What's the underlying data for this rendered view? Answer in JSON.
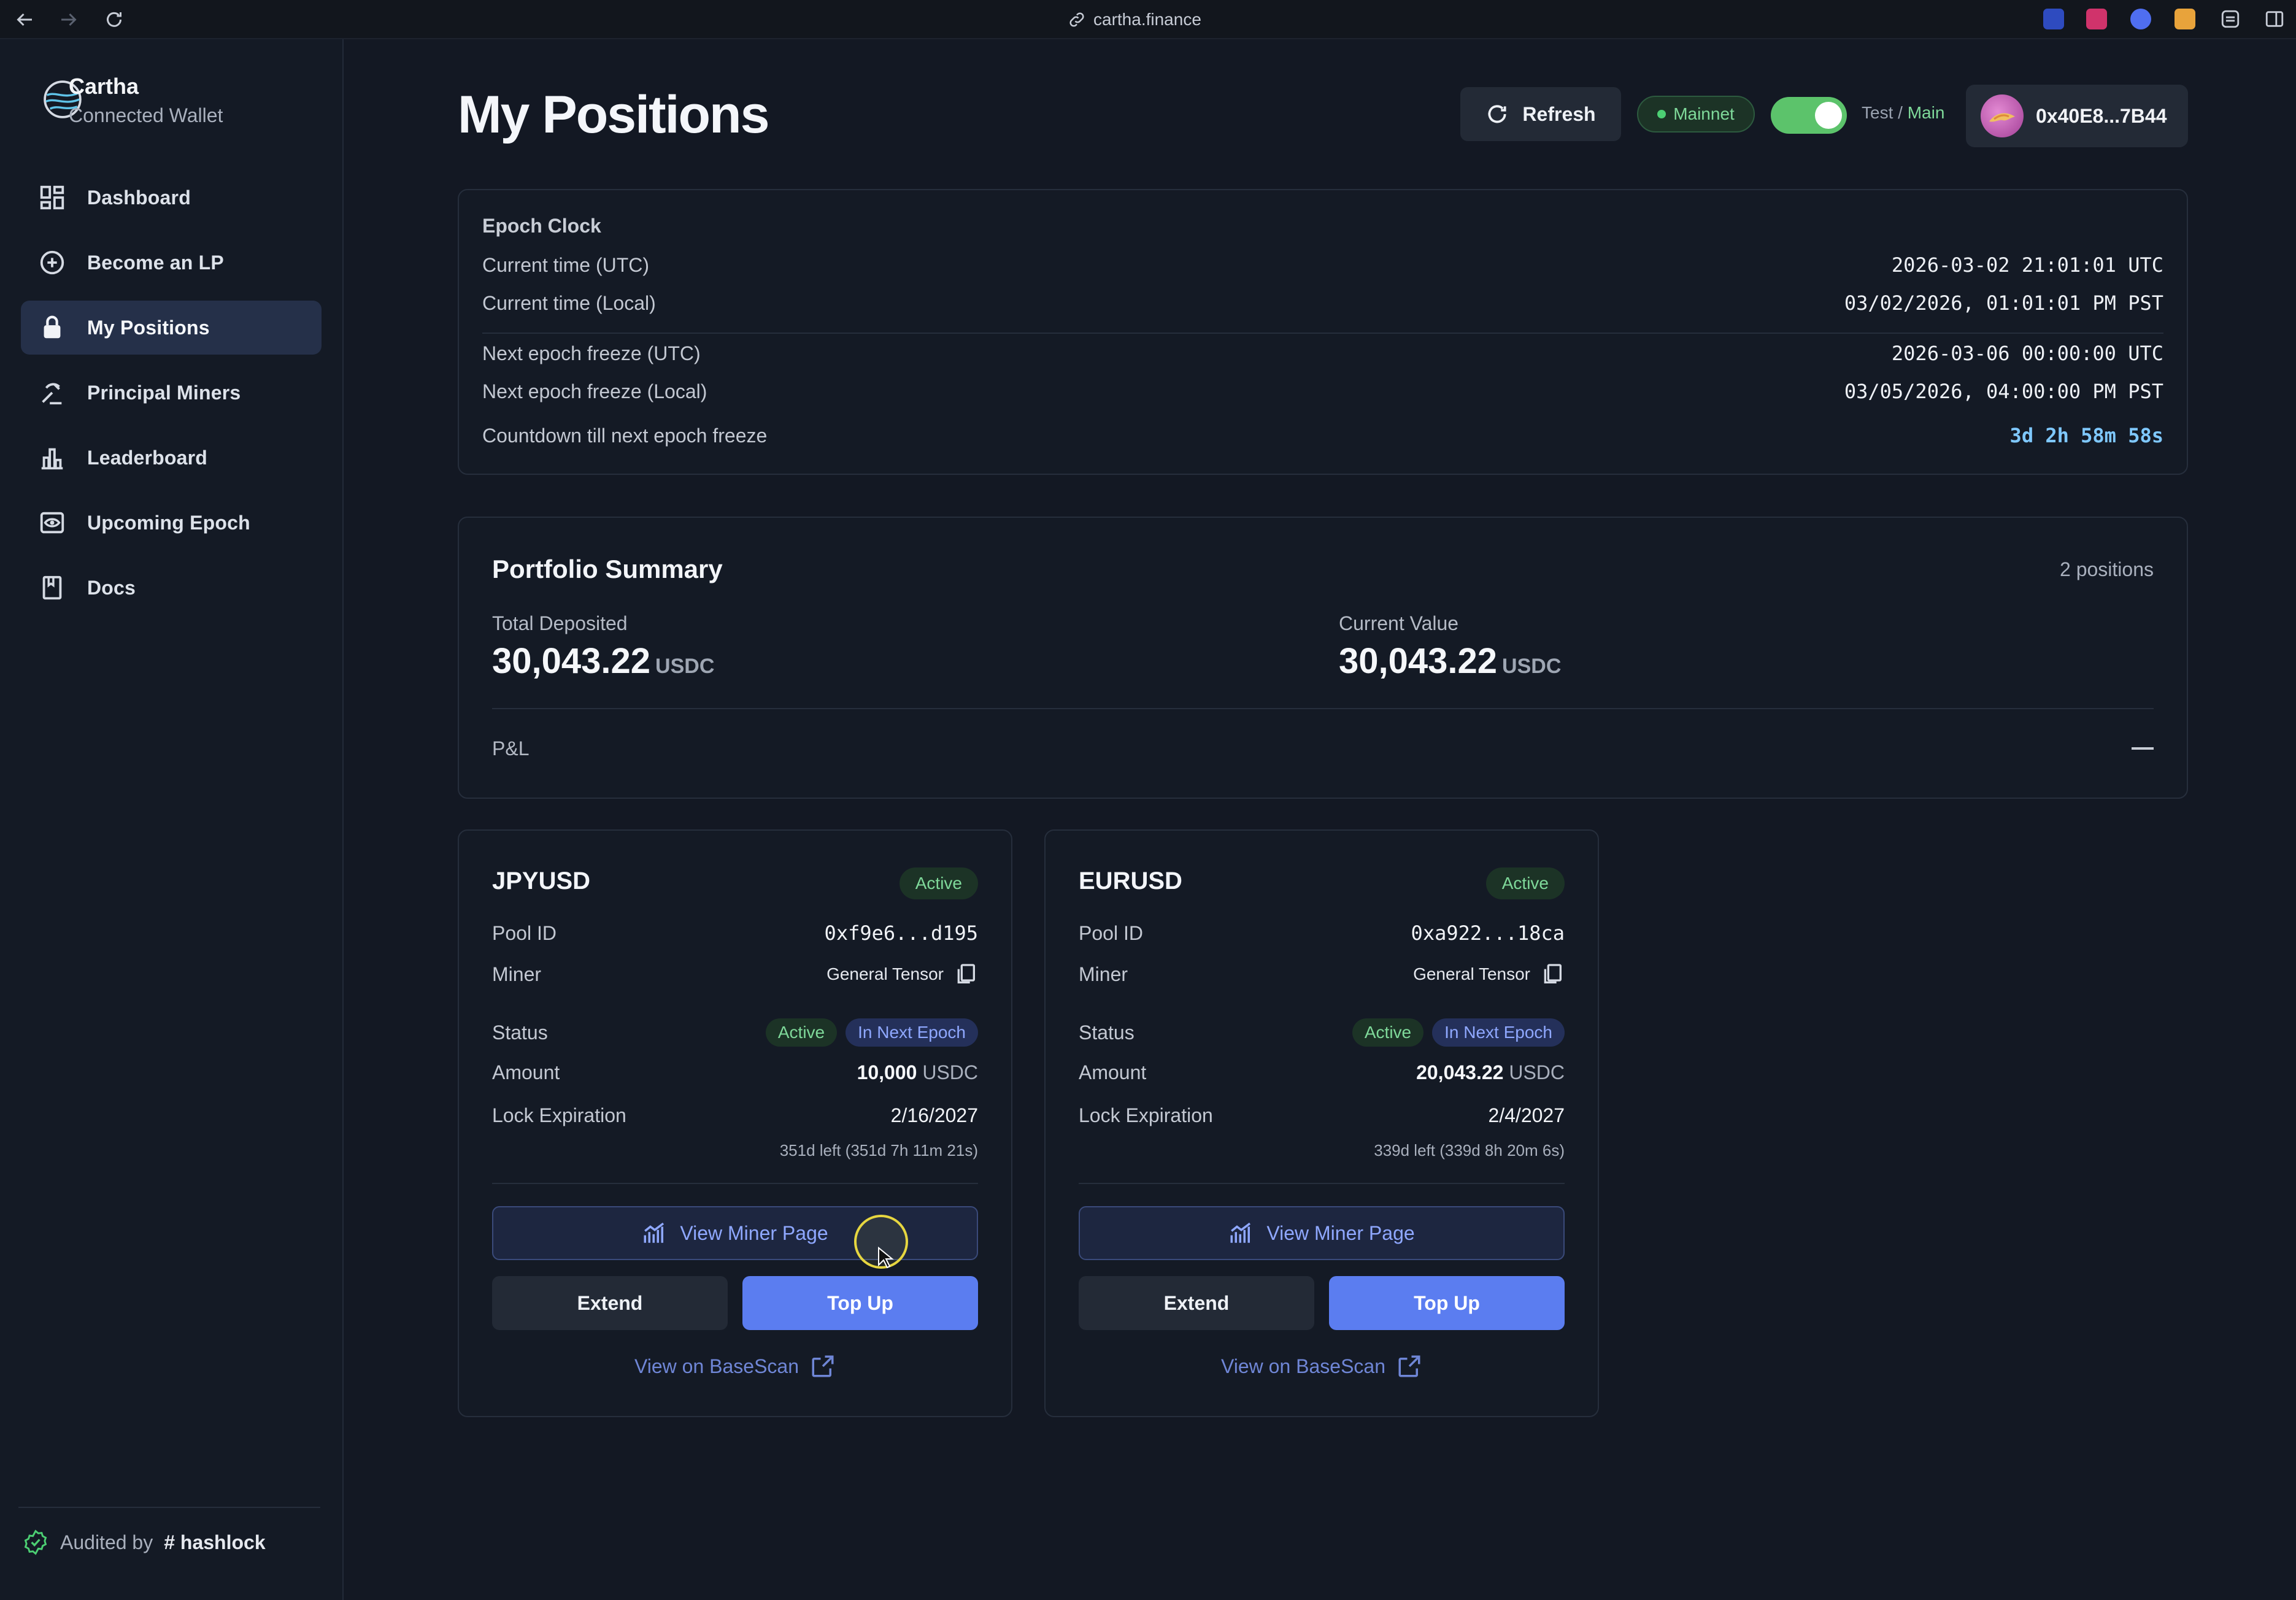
{
  "browser": {
    "url": "cartha.finance"
  },
  "sidebar": {
    "brand_title": "Cartha",
    "brand_subtitle": "Connected Wallet",
    "items": [
      {
        "label": "Dashboard",
        "icon": "dashboard-icon"
      },
      {
        "label": "Become an LP",
        "icon": "plus-circle-icon"
      },
      {
        "label": "My Positions",
        "icon": "lock-icon",
        "active": true
      },
      {
        "label": "Principal Miners",
        "icon": "mining-icon"
      },
      {
        "label": "Leaderboard",
        "icon": "bar-chart-icon"
      },
      {
        "label": "Upcoming Epoch",
        "icon": "eye-icon"
      },
      {
        "label": "Docs",
        "icon": "book-icon"
      }
    ],
    "audit_prefix": "Audited by",
    "audit_name": "# hashlock"
  },
  "header": {
    "title": "My Positions",
    "refresh_label": "Refresh",
    "network_label": "Mainnet",
    "toggle_test": "Test",
    "toggle_sep": " / ",
    "toggle_main": "Main",
    "wallet_address": "0x40E8...7B44"
  },
  "epoch": {
    "title": "Epoch Clock",
    "rows": [
      {
        "label": "Current time (UTC)",
        "value": "2026-03-02 21:01:01 UTC"
      },
      {
        "label": "Current time (Local)",
        "value": "03/02/2026, 01:01:01 PM PST"
      },
      {
        "label": "Next epoch freeze (UTC)",
        "value": "2026-03-06 00:00:00 UTC"
      },
      {
        "label": "Next epoch freeze (Local)",
        "value": "03/05/2026, 04:00:00 PM PST"
      },
      {
        "label": "Countdown till next epoch freeze",
        "value": "3d 2h 58m 58s"
      }
    ]
  },
  "portfolio": {
    "title": "Portfolio Summary",
    "count": "2 positions",
    "total_label": "Total Deposited",
    "total_value": "30,043.22",
    "current_label": "Current Value",
    "current_value": "30,043.22",
    "unit": "USDC",
    "pnl_label": "P&L"
  },
  "positions": [
    {
      "pair": "JPYUSD",
      "badge": "Active",
      "pool_label": "Pool ID",
      "pool_id": "0xf9e6...d195",
      "miner_label": "Miner",
      "miner": "General Tensor",
      "status_label": "Status",
      "status_1": "Active",
      "status_2": "In Next Epoch",
      "amount_label": "Amount",
      "amount": "10,000",
      "amount_unit": "USDC",
      "lock_label": "Lock Expiration",
      "lock_date": "2/16/2027",
      "lock_left": "351d left (351d 7h 11m 21s)",
      "view_miner": "View Miner Page",
      "extend": "Extend",
      "topup": "Top Up",
      "basescan": "View on BaseScan"
    },
    {
      "pair": "EURUSD",
      "badge": "Active",
      "pool_label": "Pool ID",
      "pool_id": "0xa922...18ca",
      "miner_label": "Miner",
      "miner": "General Tensor",
      "status_label": "Status",
      "status_1": "Active",
      "status_2": "In Next Epoch",
      "amount_label": "Amount",
      "amount": "20,043.22",
      "amount_unit": "USDC",
      "lock_label": "Lock Expiration",
      "lock_date": "2/4/2027",
      "lock_left": "339d left (339d 8h 20m 6s)",
      "view_miner": "View Miner Page",
      "extend": "Extend",
      "topup": "Top Up",
      "basescan": "View on BaseScan"
    }
  ],
  "colors": {
    "accent": "#5b7df0",
    "success": "#7fd99a",
    "background": "#131823",
    "card": "#141a25"
  }
}
